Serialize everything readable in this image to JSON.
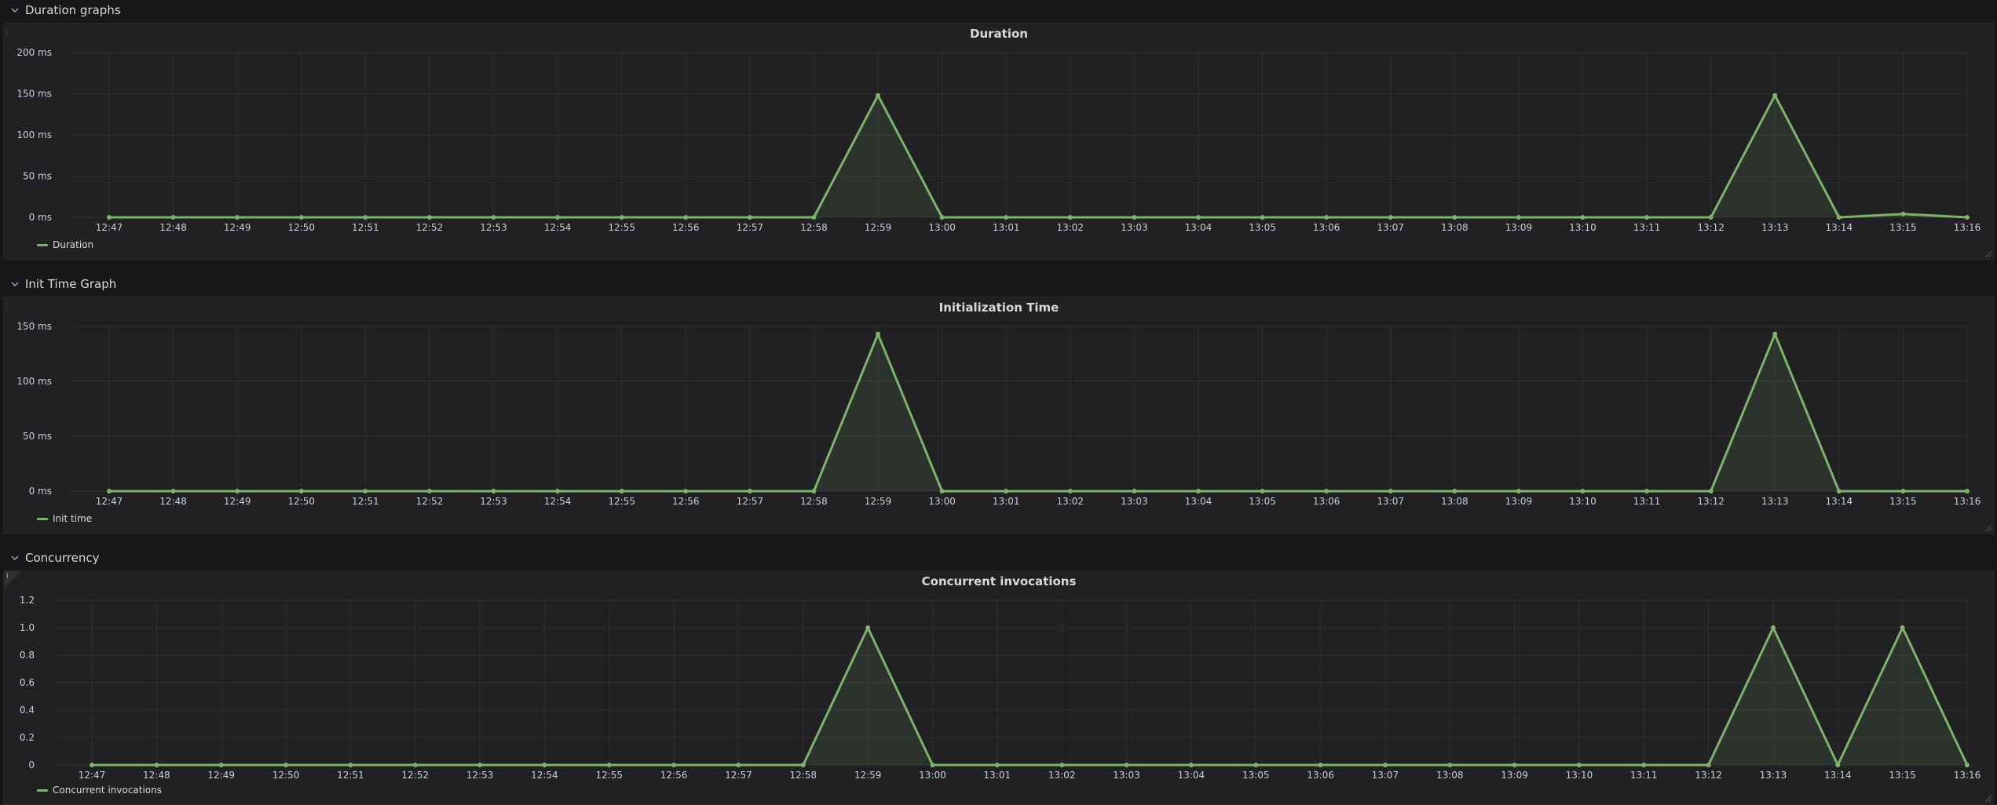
{
  "colors": {
    "series": "#7eb26d",
    "grid": "#2f2f32",
    "text": "#d8d9da",
    "tick": "#c7d0d9"
  },
  "rows": [
    {
      "title": "Duration graphs",
      "panel": {
        "title": "Duration",
        "legend": "Duration",
        "chart_data": {
          "type": "line",
          "x": [
            "12:47",
            "12:48",
            "12:49",
            "12:50",
            "12:51",
            "12:52",
            "12:53",
            "12:54",
            "12:55",
            "12:56",
            "12:57",
            "12:58",
            "12:59",
            "13:00",
            "13:01",
            "13:02",
            "13:03",
            "13:04",
            "13:05",
            "13:06",
            "13:07",
            "13:08",
            "13:09",
            "13:10",
            "13:11",
            "13:12",
            "13:13",
            "13:14",
            "13:15",
            "13:16"
          ],
          "series": [
            {
              "name": "Duration",
              "values": [
                0,
                0,
                0,
                0,
                0,
                0,
                0,
                0,
                0,
                0,
                0,
                0,
                148,
                0,
                0,
                0,
                0,
                0,
                0,
                0,
                0,
                0,
                0,
                0,
                0,
                0,
                148,
                0,
                4,
                0
              ]
            }
          ],
          "yticks": [
            "0 ms",
            "50 ms",
            "100 ms",
            "150 ms",
            "200 ms"
          ],
          "ylim": [
            0,
            200
          ],
          "fill": true,
          "grid": true,
          "legend_position": "bottom-left"
        }
      }
    },
    {
      "title": "Init Time Graph",
      "panel": {
        "title": "Initialization Time",
        "legend": "Init time",
        "chart_data": {
          "type": "line",
          "x": [
            "12:47",
            "12:48",
            "12:49",
            "12:50",
            "12:51",
            "12:52",
            "12:53",
            "12:54",
            "12:55",
            "12:56",
            "12:57",
            "12:58",
            "12:59",
            "13:00",
            "13:01",
            "13:02",
            "13:03",
            "13:04",
            "13:05",
            "13:06",
            "13:07",
            "13:08",
            "13:09",
            "13:10",
            "13:11",
            "13:12",
            "13:13",
            "13:14",
            "13:15",
            "13:16"
          ],
          "series": [
            {
              "name": "Init time",
              "values": [
                0,
                0,
                0,
                0,
                0,
                0,
                0,
                0,
                0,
                0,
                0,
                0,
                143,
                0,
                0,
                0,
                0,
                0,
                0,
                0,
                0,
                0,
                0,
                0,
                0,
                0,
                143,
                0,
                0,
                0
              ]
            }
          ],
          "yticks": [
            "0 ms",
            "50 ms",
            "100 ms",
            "150 ms"
          ],
          "ylim": [
            0,
            150
          ],
          "fill": true,
          "grid": true,
          "legend_position": "bottom-left"
        }
      }
    },
    {
      "title": "Concurrency",
      "panel": {
        "title": "Concurrent invocations",
        "legend": "Concurrent invocations",
        "info_icon": "i",
        "chart_data": {
          "type": "line",
          "x": [
            "12:47",
            "12:48",
            "12:49",
            "12:50",
            "12:51",
            "12:52",
            "12:53",
            "12:54",
            "12:55",
            "12:56",
            "12:57",
            "12:58",
            "12:59",
            "13:00",
            "13:01",
            "13:02",
            "13:03",
            "13:04",
            "13:05",
            "13:06",
            "13:07",
            "13:08",
            "13:09",
            "13:10",
            "13:11",
            "13:12",
            "13:13",
            "13:14",
            "13:15",
            "13:16"
          ],
          "series": [
            {
              "name": "Concurrent invocations",
              "values": [
                0,
                0,
                0,
                0,
                0,
                0,
                0,
                0,
                0,
                0,
                0,
                0,
                1,
                0,
                0,
                0,
                0,
                0,
                0,
                0,
                0,
                0,
                0,
                0,
                0,
                0,
                1,
                0,
                1,
                0
              ]
            }
          ],
          "yticks": [
            "0",
            "0.2",
            "0.4",
            "0.6",
            "0.8",
            "1.0",
            "1.2"
          ],
          "ylim": [
            0,
            1.2
          ],
          "fill": true,
          "grid": true,
          "legend_position": "bottom-left"
        }
      }
    }
  ]
}
